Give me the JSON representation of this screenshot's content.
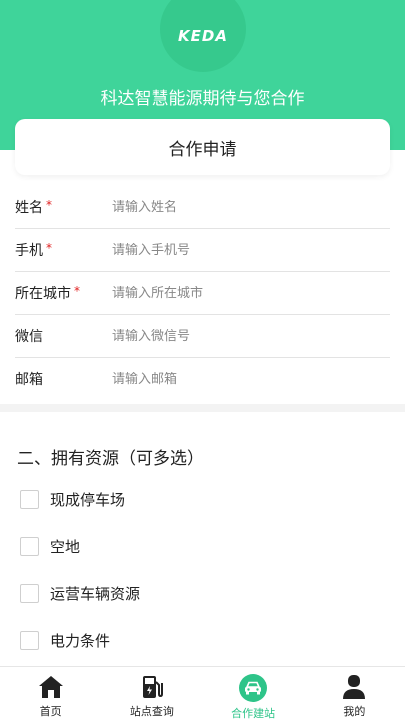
{
  "header": {
    "logo_text": "KEDA",
    "slogan": "科达智慧能源期待与您合作",
    "background": "#3fd49a"
  },
  "card": {
    "title": "合作申请"
  },
  "form": {
    "fields": [
      {
        "label": "姓名",
        "required": "*",
        "placeholder": "请输入姓名"
      },
      {
        "label": "手机",
        "required": "*",
        "placeholder": "请输入手机号"
      },
      {
        "label": "所在城市",
        "required": "*",
        "placeholder": "请输入所在城市"
      },
      {
        "label": "微信",
        "required": "",
        "placeholder": "请输入微信号"
      },
      {
        "label": "邮箱",
        "required": "",
        "placeholder": "请输入邮箱"
      }
    ]
  },
  "resources": {
    "title": "二、拥有资源（可多选）",
    "options": [
      {
        "label": "现成停车场"
      },
      {
        "label": "空地"
      },
      {
        "label": "运营车辆资源"
      },
      {
        "label": "电力条件"
      }
    ]
  },
  "tabbar": {
    "active_color": "#2ec489",
    "tabs": [
      {
        "label": "首页",
        "icon": "home-icon"
      },
      {
        "label": "站点查询",
        "icon": "charging-station-icon"
      },
      {
        "label": "合作建站",
        "icon": "car-icon"
      },
      {
        "label": "我的",
        "icon": "user-icon"
      }
    ]
  }
}
